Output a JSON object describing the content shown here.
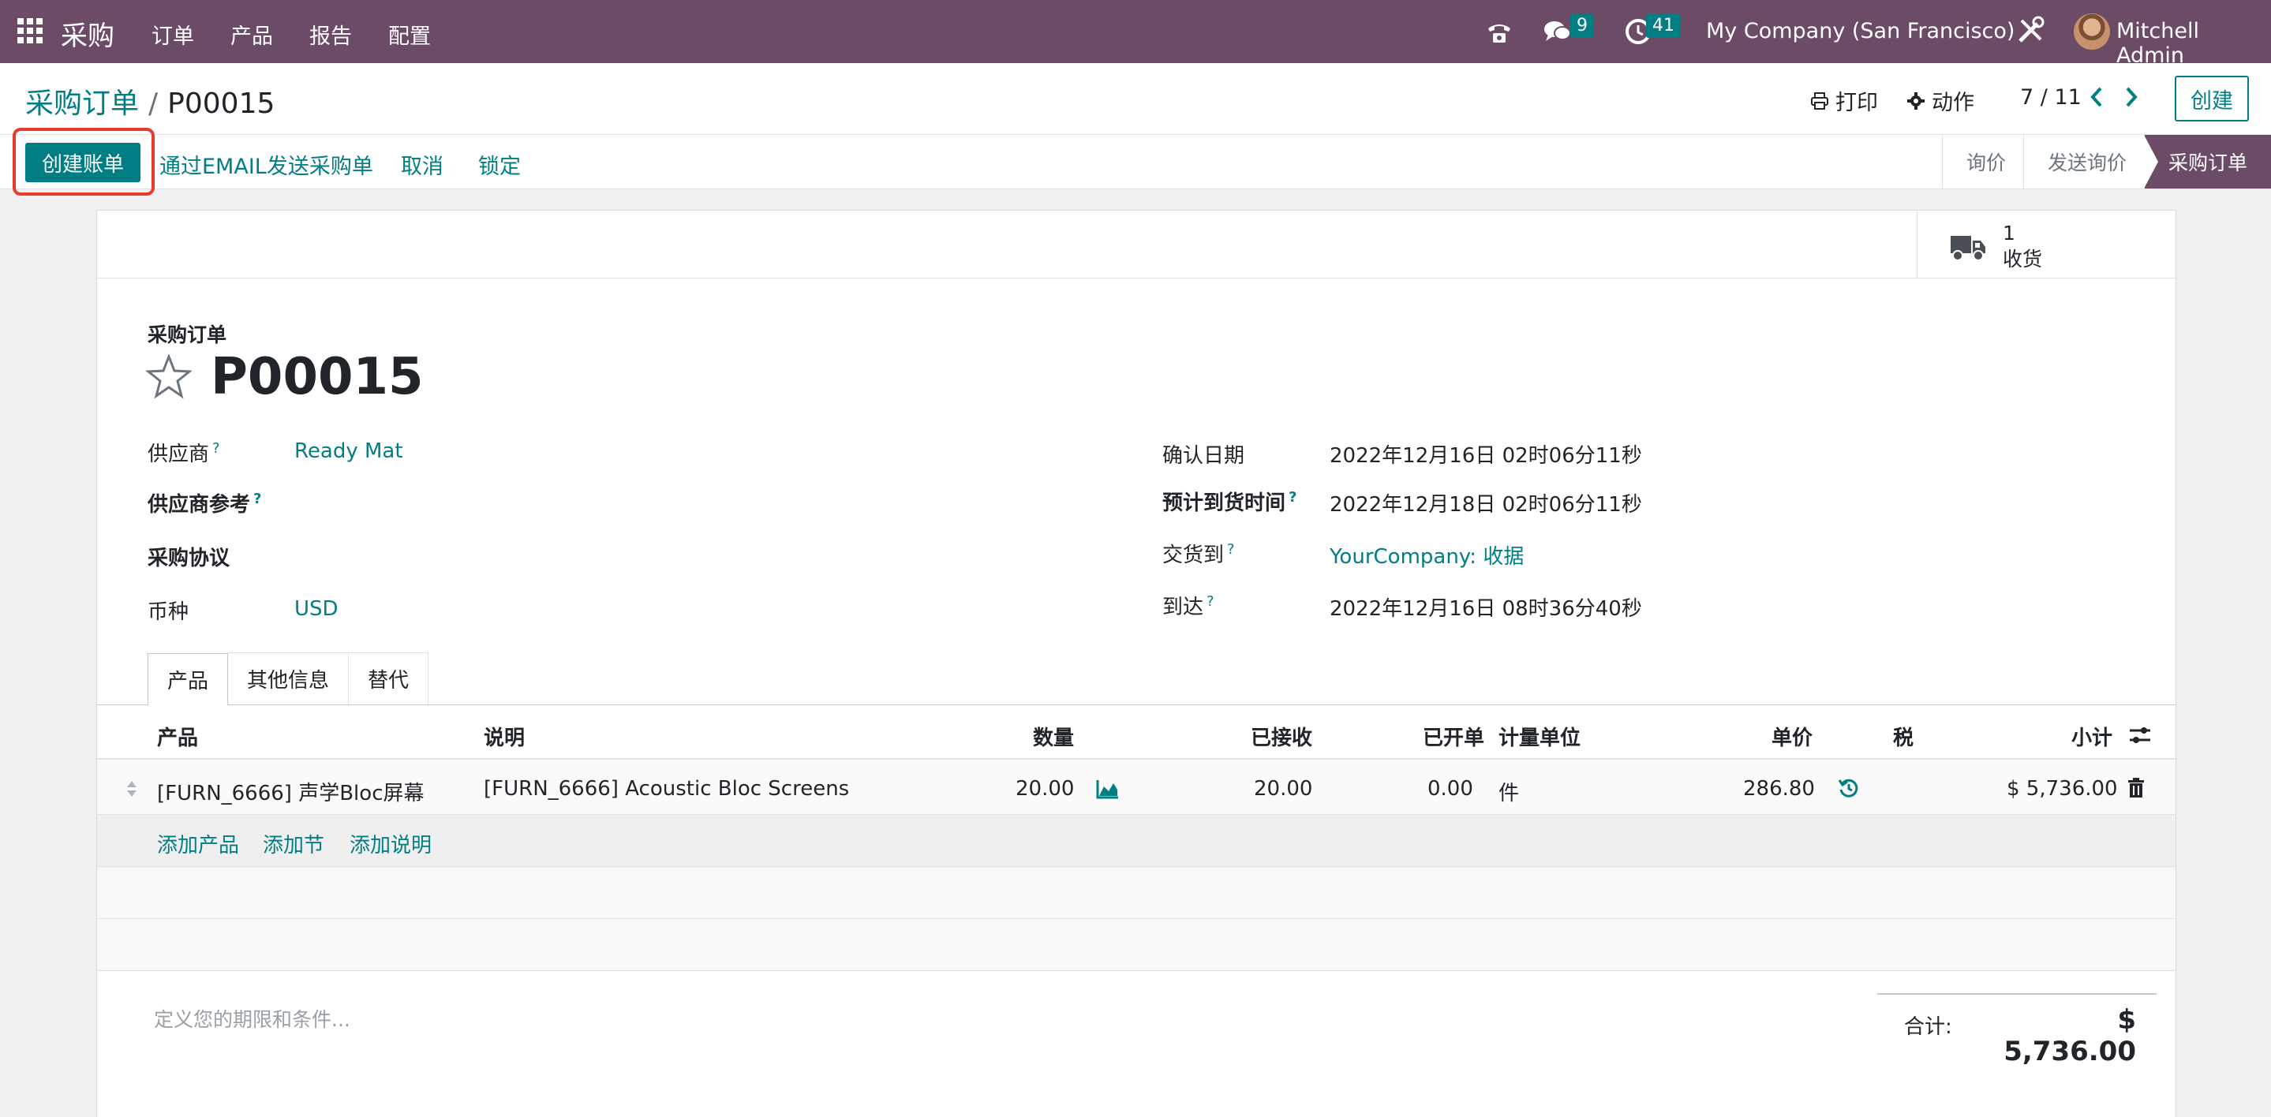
{
  "nav": {
    "app_name": "采购",
    "menu": [
      "订单",
      "产品",
      "报告",
      "配置"
    ],
    "chat_count": "9",
    "activity_count": "41",
    "company": "My Company (San Francisco)",
    "user": "Mitchell Admin"
  },
  "control": {
    "breadcrumb_parent": "采购订单",
    "breadcrumb_sep": "/",
    "breadcrumb_current": "P00015",
    "print": "打印",
    "action": "动作",
    "pager": "7 / 11",
    "create": "创建"
  },
  "statusbar": {
    "create_bill": "创建账单",
    "send_email": "通过EMAIL发送采购单",
    "cancel": "取消",
    "lock": "锁定",
    "stages": [
      "询价",
      "发送询价",
      "采购订单"
    ],
    "active_stage": "采购订单"
  },
  "smart_button": {
    "value": "1",
    "label": "收货"
  },
  "form": {
    "title_label": "采购订单",
    "title": "P00015",
    "vendor_label": "供应商",
    "vendor": "Ready Mat",
    "vendor_ref_label": "供应商参考",
    "agreement_label": "采购协议",
    "currency_label": "币种",
    "currency": "USD",
    "confirm_date_label": "确认日期",
    "confirm_date": "2022年12月16日 02时06分11秒",
    "expected_arrival_label": "预计到货时间",
    "expected_arrival": "2022年12月18日 02时06分11秒",
    "deliver_to_label": "交货到",
    "deliver_to": "YourCompany: 收据",
    "arrival_label": "到达",
    "arrival": "2022年12月16日 08时36分40秒",
    "help_mark": "?"
  },
  "tabs": [
    "产品",
    "其他信息",
    "替代"
  ],
  "table": {
    "headers": {
      "product": "产品",
      "description": "说明",
      "qty": "数量",
      "received": "已接收",
      "billed": "已开单",
      "uom": "计量单位",
      "price": "单价",
      "tax": "税",
      "subtotal": "小计"
    },
    "rows": [
      {
        "product": "[FURN_6666] 声学Bloc屏幕",
        "description": "[FURN_6666] Acoustic Bloc Screens",
        "qty": "20.00",
        "received": "20.00",
        "billed": "0.00",
        "uom": "件",
        "price": "286.80",
        "subtotal": "$ 5,736.00"
      }
    ],
    "add_product": "添加产品",
    "add_section": "添加节",
    "add_note": "添加说明"
  },
  "footer": {
    "terms_placeholder": "定义您的期限和条件...",
    "total_label": "合计:",
    "total_value": "$ 5,736.00"
  },
  "colors": {
    "brand": "#6c4b66",
    "accent": "#017e84",
    "highlight": "#e63c2f"
  }
}
